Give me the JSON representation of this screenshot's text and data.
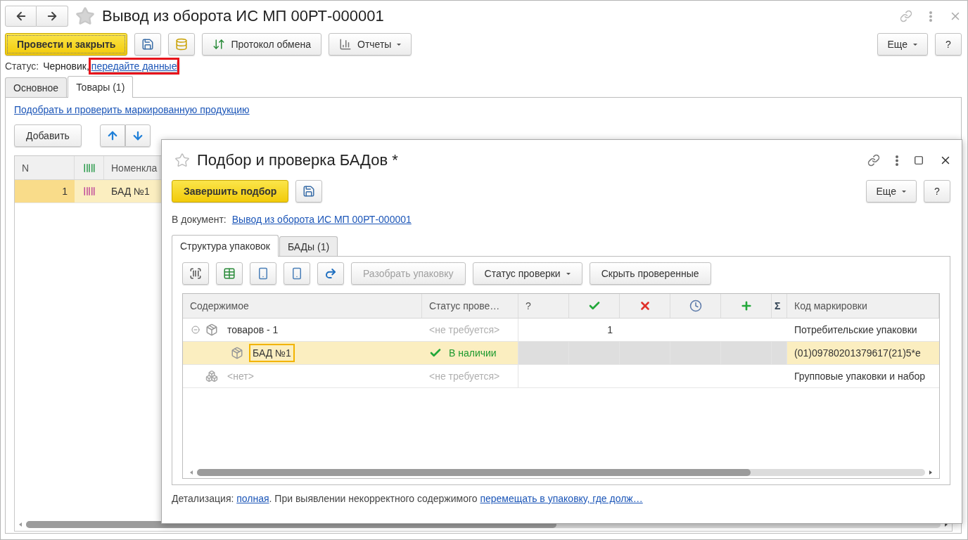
{
  "window": {
    "title": "Вывод из оборота ИС МП 00РТ-000001"
  },
  "toolbar": [
    {
      "kind": "primary",
      "label": "Провести и закрыть"
    },
    {
      "kind": "save"
    },
    {
      "kind": "post"
    },
    {
      "kind": "protocol",
      "label": "Протокол обмена"
    },
    {
      "kind": "reports",
      "label": "Отчеты"
    }
  ],
  "right_buttons": [
    {
      "kind": "menu",
      "label": "Еще"
    },
    {
      "kind": "help",
      "label": "?"
    }
  ],
  "status": {
    "label": "Статус:",
    "value": "Черновик,",
    "link": "передайте данные",
    "highlighted": true
  },
  "tabs": [
    {
      "label": "Основное",
      "selected": false
    },
    {
      "label": "Товары (1)",
      "selected": true
    }
  ],
  "goods": {
    "link": "Подобрать и проверить маркированную продукцию",
    "add_button": "Добавить",
    "columns": [
      {
        "kind": "text",
        "title": "N"
      },
      {
        "kind": "mark"
      },
      {
        "kind": "text",
        "title": "Номенкла"
      }
    ],
    "rows": [
      {
        "number": "1",
        "name": "БАД №1",
        "selected": true
      }
    ]
  },
  "dialog": {
    "title": "Подбор и проверка БАДов *",
    "finish_button": "Завершить подбор",
    "more_button": "Еще",
    "help_button": "?",
    "document_label": "В документ:",
    "document_link": "Вывод из оборота ИС МП 00РТ-000001",
    "tabs": [
      {
        "label": "Структура упаковок",
        "selected": true
      },
      {
        "label": "БАДы (1)",
        "selected": false
      }
    ],
    "tools": [
      {
        "kind": "scan"
      },
      {
        "kind": "import"
      },
      {
        "kind": "upload"
      },
      {
        "kind": "download"
      },
      {
        "kind": "redo"
      }
    ],
    "buttons": [
      {
        "label": "Разобрать упаковку",
        "disabled": true,
        "menu": false
      },
      {
        "label": "Статус проверки",
        "disabled": false,
        "menu": true
      },
      {
        "label": "Скрыть проверенные",
        "disabled": false,
        "menu": false
      }
    ],
    "columns": [
      {
        "kind": "content",
        "title": "Содержимое"
      },
      {
        "kind": "status",
        "title": "Статус прове…"
      },
      {
        "kind": "unknown",
        "title": "?"
      },
      {
        "kind": "found"
      },
      {
        "kind": "error"
      },
      {
        "kind": "pending"
      },
      {
        "kind": "extra"
      },
      {
        "kind": "total",
        "title": "Σ"
      },
      {
        "kind": "code",
        "title": "Код маркировки"
      }
    ],
    "rows": [
      {
        "name": "товаров - 1",
        "kind": "unit",
        "muted": false,
        "status": "<не требуется>",
        "verified": false,
        "counts": {
          "found": "1"
        },
        "code": "Потребительские упаковки",
        "selected": false,
        "expanded": true,
        "children": [
          {
            "name": "БАД №1",
            "kind": "unit",
            "muted": false,
            "status": "В наличии",
            "verified": true,
            "code": "(01)09780201379617(21)5*e",
            "selected": true
          }
        ]
      },
      {
        "name": "<нет>",
        "kind": "group",
        "muted": true,
        "status": "<не требуется>",
        "verified": false,
        "code": "Групповые упаковки и набор",
        "selected": false
      }
    ],
    "footer": {
      "label": "Детализация:",
      "detail_link": "полная",
      "text": ". При выявлении некорректного содержимого",
      "action_link": "перемещать в упаковку, где долж…"
    }
  }
}
